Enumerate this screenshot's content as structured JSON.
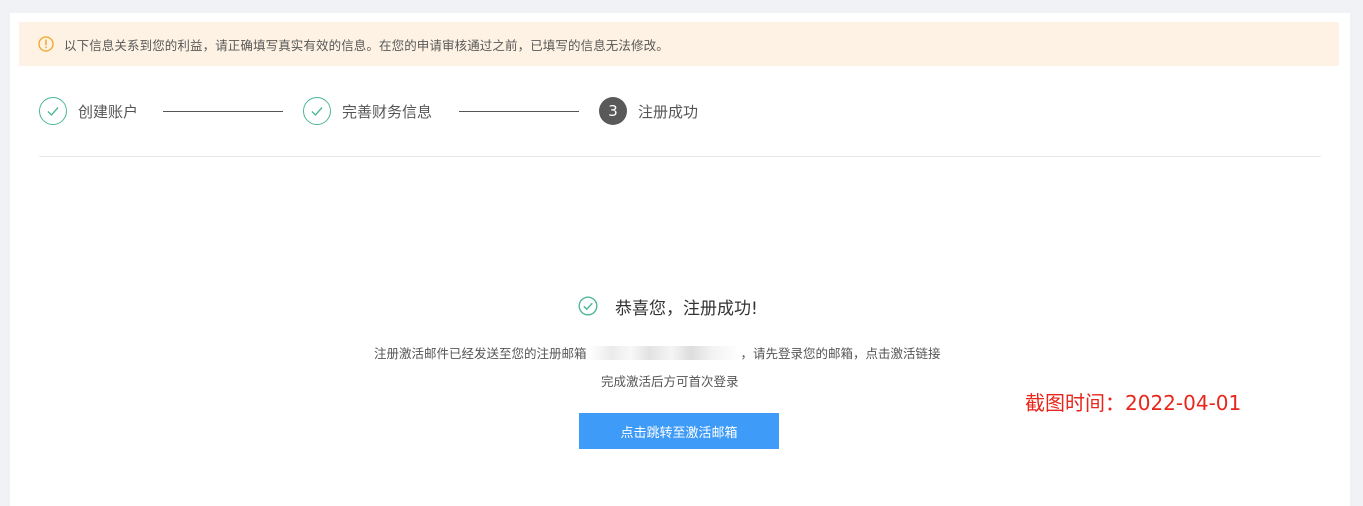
{
  "notice": {
    "icon": "info-circle-icon",
    "text": "以下信息关系到您的利益，请正确填写真实有效的信息。在您的申请审核通过之前，已填写的信息无法修改。",
    "color": "#fdf2e3"
  },
  "steps": [
    {
      "label": "创建账户",
      "state": "done",
      "icon": "check-icon"
    },
    {
      "label": "完善财务信息",
      "state": "done",
      "icon": "check-icon"
    },
    {
      "label": "注册成功",
      "state": "current",
      "number": "3"
    }
  ],
  "result": {
    "icon": "check-circle-icon",
    "title": "恭喜您，注册成功!",
    "desc_before_email": "注册激活邮件已经发送至您的注册邮箱",
    "desc_after_email": "，请先登录您的邮箱，点击激活链接",
    "desc_line2": "完成激活后方可首次登录",
    "button_label": "点击跳转至激活邮箱",
    "button_color": "#3f9bf8",
    "accent_color": "#4fb79a"
  },
  "screenshot_time": "截图时间：2022-04-01"
}
